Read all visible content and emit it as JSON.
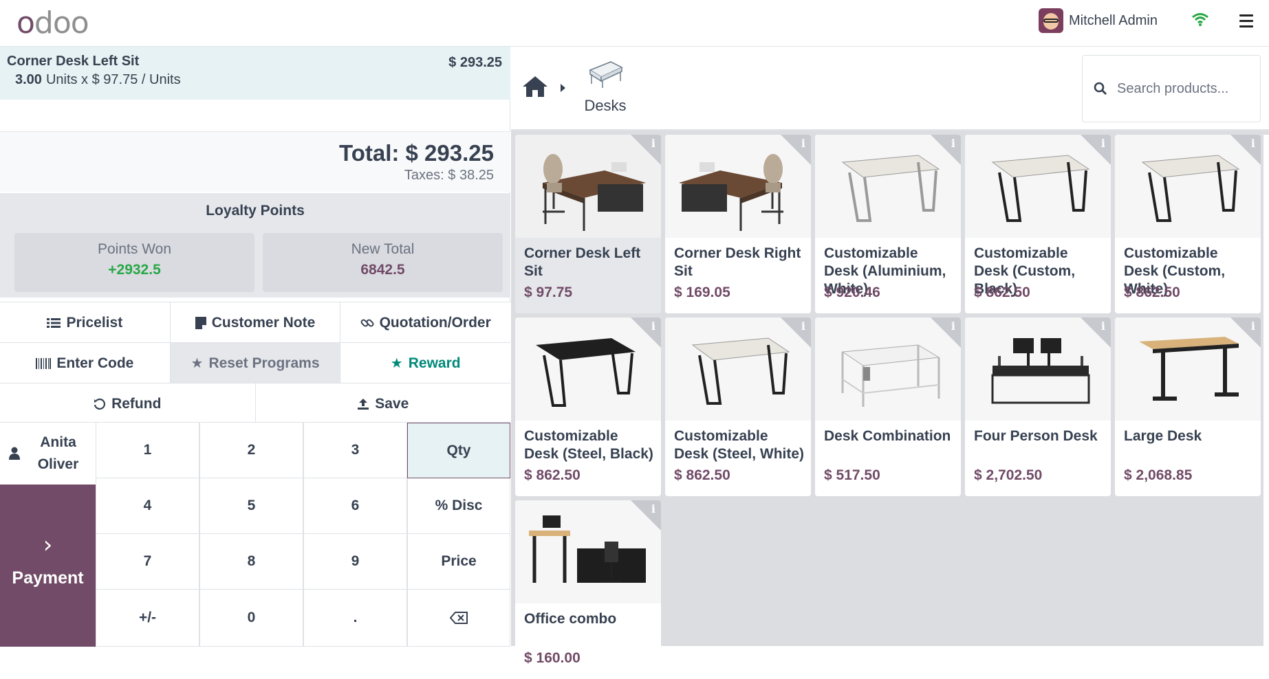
{
  "topbar": {
    "logo": "odoo",
    "user_name": "Mitchell Admin"
  },
  "order": {
    "line": {
      "name": "Corner Desk Left Sit",
      "price": "$ 293.25",
      "qty": "3.00",
      "qty_detail": "Units x $ 97.75 / Units"
    },
    "total": "Total: $ 293.25",
    "taxes": "Taxes: $ 38.25"
  },
  "loyalty": {
    "title": "Loyalty Points",
    "won_label": "Points Won",
    "won_value": "+2932.5",
    "new_total_label": "New Total",
    "new_total_value": "6842.5",
    "won_color": "#28a745",
    "new_total_color": "#714b67"
  },
  "controls": {
    "pricelist": "Pricelist",
    "customer_note": "Customer Note",
    "quotation": "Quotation/Order",
    "enter_code": "Enter Code",
    "reset_programs": "Reset Programs",
    "reward": "Reward",
    "refund": "Refund",
    "save": "Save"
  },
  "customer": {
    "name": "Anita Oliver"
  },
  "payment": {
    "label": "Payment"
  },
  "numpad": {
    "keys": [
      "1",
      "2",
      "3",
      "Qty",
      "4",
      "5",
      "6",
      "% Disc",
      "7",
      "8",
      "9",
      "Price",
      "+/-",
      "0",
      "."
    ],
    "backspace_icon": "backspace-icon",
    "active": "Qty"
  },
  "catalog": {
    "category": "Desks",
    "search_placeholder": "Search products..."
  },
  "products": [
    {
      "name": "Corner Desk Left Sit",
      "price": "$ 97.75"
    },
    {
      "name": "Corner Desk Right Sit",
      "price": "$ 169.05"
    },
    {
      "name": "Customizable Desk (Aluminium, White)",
      "price": "$ 920.46"
    },
    {
      "name": "Customizable Desk (Custom, Black)",
      "price": "$ 862.50"
    },
    {
      "name": "Customizable Desk (Custom, White)",
      "price": "$ 862.50"
    },
    {
      "name": "Customizable Desk (Steel, Black)",
      "price": "$ 862.50"
    },
    {
      "name": "Customizable Desk (Steel, White)",
      "price": "$ 862.50"
    },
    {
      "name": "Desk Combination",
      "price": "$ 517.50"
    },
    {
      "name": "Four Person Desk",
      "price": "$ 2,702.50"
    },
    {
      "name": "Large Desk",
      "price": "$ 2,068.85"
    },
    {
      "name": "Office combo",
      "price": "$ 160.00"
    }
  ],
  "colors": {
    "brand": "#714b67",
    "reward": "#018a79",
    "accent_bg": "#e6f2f3"
  }
}
